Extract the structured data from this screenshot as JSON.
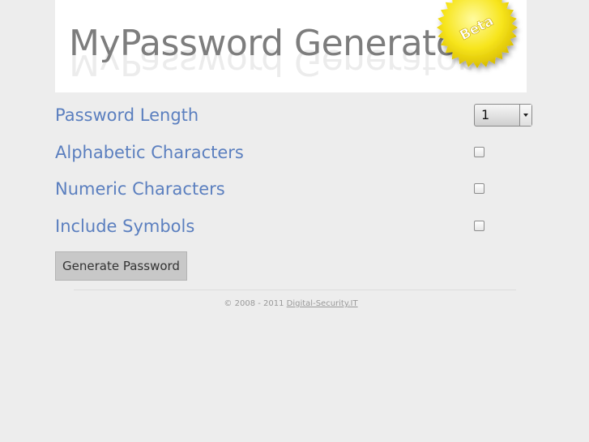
{
  "header": {
    "logo_text": "MyPassword Generator",
    "badge_text": "Beta"
  },
  "form": {
    "length_label": "Password Length",
    "length_value": "1",
    "alpha_label": "Alphabetic Characters",
    "numeric_label": "Numeric Characters",
    "symbols_label": "Include Symbols",
    "generate_label": "Generate Password"
  },
  "footer": {
    "copyright": "© 2008 - 2011",
    "link_text": "Digital-Security.IT"
  },
  "colors": {
    "background": "#ededed",
    "label": "#5b7fbf",
    "badge": "#f7e51c"
  },
  "icons": {
    "badge": "starburst-seal-icon",
    "select": "chevron-down-icon"
  }
}
